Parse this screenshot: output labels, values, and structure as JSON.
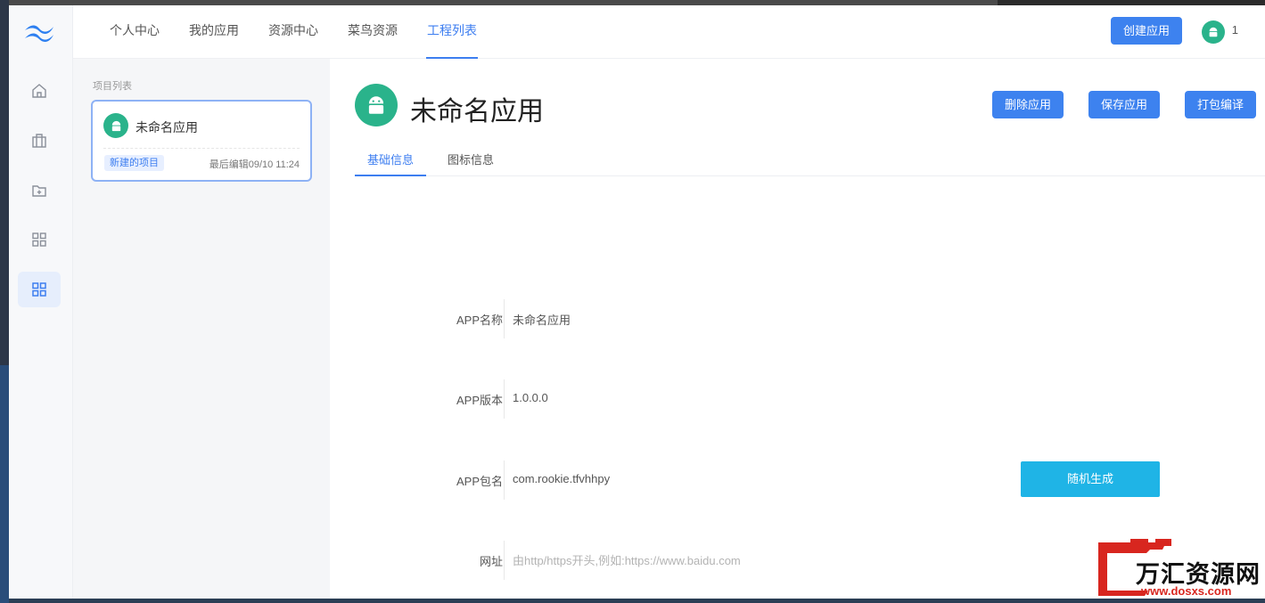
{
  "nav": {
    "items": [
      {
        "label": "个人中心",
        "active": false
      },
      {
        "label": "我的应用",
        "active": false
      },
      {
        "label": "资源中心",
        "active": false
      },
      {
        "label": "菜鸟资源",
        "active": false
      },
      {
        "label": "工程列表",
        "active": true
      }
    ],
    "create_button": "创建应用",
    "user_count": "1"
  },
  "sidebar": {
    "items": [
      {
        "icon": "home-icon",
        "active": false
      },
      {
        "icon": "briefcase-icon",
        "active": false
      },
      {
        "icon": "folder-add-icon",
        "active": false
      },
      {
        "icon": "grid-icon",
        "active": false
      },
      {
        "icon": "grid-icon",
        "active": true
      }
    ]
  },
  "projects": {
    "title": "项目列表",
    "card": {
      "name": "未命名应用",
      "tag": "新建的项目",
      "time": "最后编辑09/10 11:24"
    }
  },
  "main": {
    "title": "未命名应用",
    "actions": {
      "delete": "删除应用",
      "save": "保存应用",
      "build": "打包编译"
    },
    "tabs": [
      {
        "label": "基础信息",
        "active": true
      },
      {
        "label": "图标信息",
        "active": false
      }
    ],
    "form": {
      "name_label": "APP名称",
      "name_value": "未命名应用",
      "version_label": "APP版本",
      "version_value": "1.0.0.0",
      "package_label": "APP包名",
      "package_value": "com.rookie.tfvhhpy",
      "random_button": "随机生成",
      "url_label": "网址",
      "url_placeholder": "由http/https开头,例如:https://www.baidu.com"
    }
  },
  "watermark": {
    "text": "万汇资源网",
    "url": "www.dosxs.com"
  },
  "colors": {
    "accent": "#3d82ef",
    "android_green": "#2ab38b",
    "random_button": "#1fb4e6",
    "watermark_red": "#d8261f"
  }
}
